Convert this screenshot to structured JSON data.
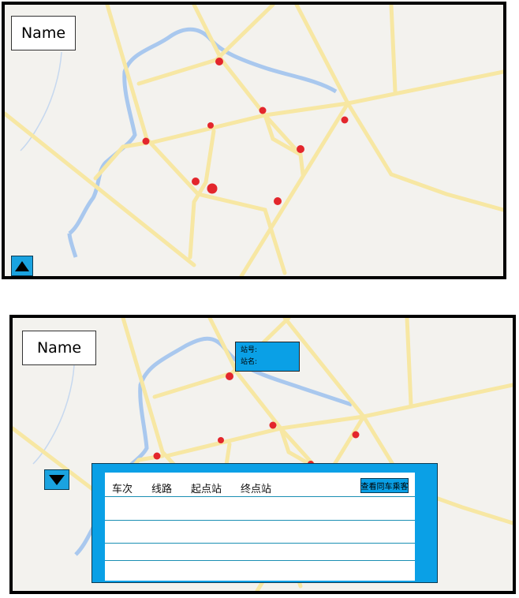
{
  "top_panel": {
    "name_label": "Name",
    "toggle_icon": "triangle-up-icon"
  },
  "bottom_panel": {
    "name_label": "Name",
    "toggle_icon": "triangle-down-icon",
    "station_tooltip": {
      "station_no_label": "站号:",
      "station_name_label": "站名:"
    },
    "trip_table": {
      "headers": [
        "车次",
        "线路",
        "起点站",
        "终点站"
      ],
      "query_button_label": "查看同车乘客",
      "rows": [
        [],
        [],
        [],
        []
      ]
    }
  },
  "colors": {
    "map_background": "#f3f2ee",
    "road": "#f7e7a3",
    "river": "#a9c8ee",
    "station_marker": "#e3262c",
    "popup_blue": "#0aa0e6"
  }
}
